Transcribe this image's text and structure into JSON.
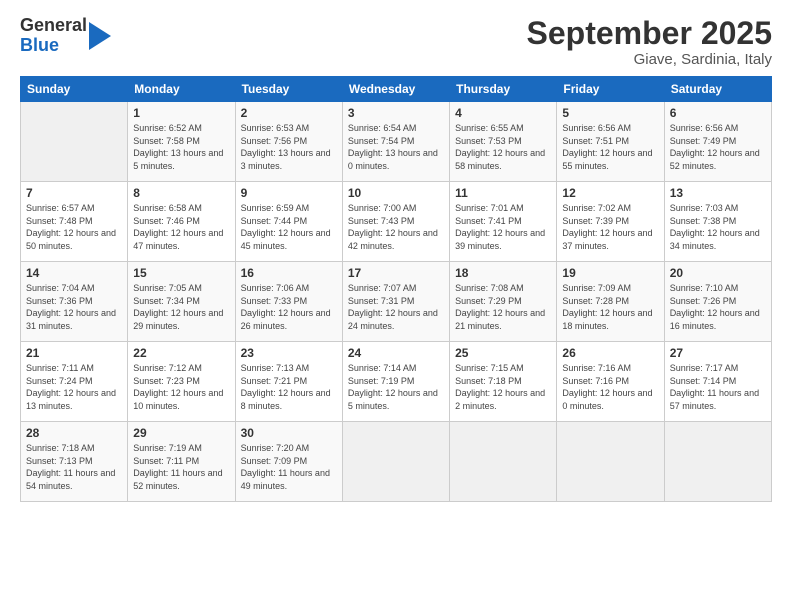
{
  "logo": {
    "general": "General",
    "blue": "Blue"
  },
  "title": "September 2025",
  "location": "Giave, Sardinia, Italy",
  "headers": [
    "Sunday",
    "Monday",
    "Tuesday",
    "Wednesday",
    "Thursday",
    "Friday",
    "Saturday"
  ],
  "weeks": [
    [
      {
        "day": "",
        "sunrise": "",
        "sunset": "",
        "daylight": ""
      },
      {
        "day": "1",
        "sunrise": "Sunrise: 6:52 AM",
        "sunset": "Sunset: 7:58 PM",
        "daylight": "Daylight: 13 hours and 5 minutes."
      },
      {
        "day": "2",
        "sunrise": "Sunrise: 6:53 AM",
        "sunset": "Sunset: 7:56 PM",
        "daylight": "Daylight: 13 hours and 3 minutes."
      },
      {
        "day": "3",
        "sunrise": "Sunrise: 6:54 AM",
        "sunset": "Sunset: 7:54 PM",
        "daylight": "Daylight: 13 hours and 0 minutes."
      },
      {
        "day": "4",
        "sunrise": "Sunrise: 6:55 AM",
        "sunset": "Sunset: 7:53 PM",
        "daylight": "Daylight: 12 hours and 58 minutes."
      },
      {
        "day": "5",
        "sunrise": "Sunrise: 6:56 AM",
        "sunset": "Sunset: 7:51 PM",
        "daylight": "Daylight: 12 hours and 55 minutes."
      },
      {
        "day": "6",
        "sunrise": "Sunrise: 6:56 AM",
        "sunset": "Sunset: 7:49 PM",
        "daylight": "Daylight: 12 hours and 52 minutes."
      }
    ],
    [
      {
        "day": "7",
        "sunrise": "Sunrise: 6:57 AM",
        "sunset": "Sunset: 7:48 PM",
        "daylight": "Daylight: 12 hours and 50 minutes."
      },
      {
        "day": "8",
        "sunrise": "Sunrise: 6:58 AM",
        "sunset": "Sunset: 7:46 PM",
        "daylight": "Daylight: 12 hours and 47 minutes."
      },
      {
        "day": "9",
        "sunrise": "Sunrise: 6:59 AM",
        "sunset": "Sunset: 7:44 PM",
        "daylight": "Daylight: 12 hours and 45 minutes."
      },
      {
        "day": "10",
        "sunrise": "Sunrise: 7:00 AM",
        "sunset": "Sunset: 7:43 PM",
        "daylight": "Daylight: 12 hours and 42 minutes."
      },
      {
        "day": "11",
        "sunrise": "Sunrise: 7:01 AM",
        "sunset": "Sunset: 7:41 PM",
        "daylight": "Daylight: 12 hours and 39 minutes."
      },
      {
        "day": "12",
        "sunrise": "Sunrise: 7:02 AM",
        "sunset": "Sunset: 7:39 PM",
        "daylight": "Daylight: 12 hours and 37 minutes."
      },
      {
        "day": "13",
        "sunrise": "Sunrise: 7:03 AM",
        "sunset": "Sunset: 7:38 PM",
        "daylight": "Daylight: 12 hours and 34 minutes."
      }
    ],
    [
      {
        "day": "14",
        "sunrise": "Sunrise: 7:04 AM",
        "sunset": "Sunset: 7:36 PM",
        "daylight": "Daylight: 12 hours and 31 minutes."
      },
      {
        "day": "15",
        "sunrise": "Sunrise: 7:05 AM",
        "sunset": "Sunset: 7:34 PM",
        "daylight": "Daylight: 12 hours and 29 minutes."
      },
      {
        "day": "16",
        "sunrise": "Sunrise: 7:06 AM",
        "sunset": "Sunset: 7:33 PM",
        "daylight": "Daylight: 12 hours and 26 minutes."
      },
      {
        "day": "17",
        "sunrise": "Sunrise: 7:07 AM",
        "sunset": "Sunset: 7:31 PM",
        "daylight": "Daylight: 12 hours and 24 minutes."
      },
      {
        "day": "18",
        "sunrise": "Sunrise: 7:08 AM",
        "sunset": "Sunset: 7:29 PM",
        "daylight": "Daylight: 12 hours and 21 minutes."
      },
      {
        "day": "19",
        "sunrise": "Sunrise: 7:09 AM",
        "sunset": "Sunset: 7:28 PM",
        "daylight": "Daylight: 12 hours and 18 minutes."
      },
      {
        "day": "20",
        "sunrise": "Sunrise: 7:10 AM",
        "sunset": "Sunset: 7:26 PM",
        "daylight": "Daylight: 12 hours and 16 minutes."
      }
    ],
    [
      {
        "day": "21",
        "sunrise": "Sunrise: 7:11 AM",
        "sunset": "Sunset: 7:24 PM",
        "daylight": "Daylight: 12 hours and 13 minutes."
      },
      {
        "day": "22",
        "sunrise": "Sunrise: 7:12 AM",
        "sunset": "Sunset: 7:23 PM",
        "daylight": "Daylight: 12 hours and 10 minutes."
      },
      {
        "day": "23",
        "sunrise": "Sunrise: 7:13 AM",
        "sunset": "Sunset: 7:21 PM",
        "daylight": "Daylight: 12 hours and 8 minutes."
      },
      {
        "day": "24",
        "sunrise": "Sunrise: 7:14 AM",
        "sunset": "Sunset: 7:19 PM",
        "daylight": "Daylight: 12 hours and 5 minutes."
      },
      {
        "day": "25",
        "sunrise": "Sunrise: 7:15 AM",
        "sunset": "Sunset: 7:18 PM",
        "daylight": "Daylight: 12 hours and 2 minutes."
      },
      {
        "day": "26",
        "sunrise": "Sunrise: 7:16 AM",
        "sunset": "Sunset: 7:16 PM",
        "daylight": "Daylight: 12 hours and 0 minutes."
      },
      {
        "day": "27",
        "sunrise": "Sunrise: 7:17 AM",
        "sunset": "Sunset: 7:14 PM",
        "daylight": "Daylight: 11 hours and 57 minutes."
      }
    ],
    [
      {
        "day": "28",
        "sunrise": "Sunrise: 7:18 AM",
        "sunset": "Sunset: 7:13 PM",
        "daylight": "Daylight: 11 hours and 54 minutes."
      },
      {
        "day": "29",
        "sunrise": "Sunrise: 7:19 AM",
        "sunset": "Sunset: 7:11 PM",
        "daylight": "Daylight: 11 hours and 52 minutes."
      },
      {
        "day": "30",
        "sunrise": "Sunrise: 7:20 AM",
        "sunset": "Sunset: 7:09 PM",
        "daylight": "Daylight: 11 hours and 49 minutes."
      },
      {
        "day": "",
        "sunrise": "",
        "sunset": "",
        "daylight": ""
      },
      {
        "day": "",
        "sunrise": "",
        "sunset": "",
        "daylight": ""
      },
      {
        "day": "",
        "sunrise": "",
        "sunset": "",
        "daylight": ""
      },
      {
        "day": "",
        "sunrise": "",
        "sunset": "",
        "daylight": ""
      }
    ]
  ]
}
